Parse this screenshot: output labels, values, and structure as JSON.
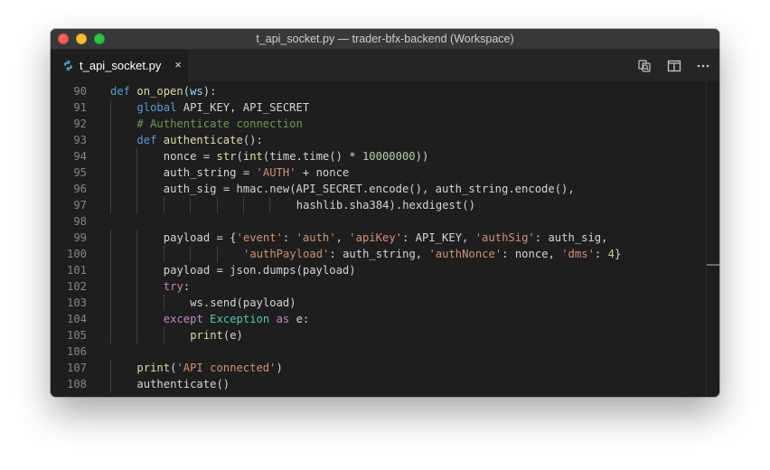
{
  "window": {
    "title": "t_api_socket.py — trader-bfx-backend (Workspace)"
  },
  "tabs": [
    {
      "label": "t_api_socket.py",
      "icon": "python-icon",
      "close": "×"
    }
  ],
  "actions": [
    {
      "name": "open-changes-icon"
    },
    {
      "name": "split-editor-icon"
    },
    {
      "name": "more-actions-icon"
    }
  ],
  "theme": {
    "background": "#1e1e1e",
    "keyword": "#569cd6",
    "function": "#dcdcaa",
    "control": "#c586c0",
    "string": "#ce9178",
    "number": "#b5cea8",
    "comment": "#6a9955",
    "class": "#4ec9b0",
    "variable": "#9cdcfe"
  },
  "code_lines": [
    {
      "n": "90",
      "indent": 0,
      "tokens": [
        [
          "kw-def",
          "def"
        ],
        [
          "plain",
          " "
        ],
        [
          "fn",
          "on_open"
        ],
        [
          "plain",
          "("
        ],
        [
          "var",
          "ws"
        ],
        [
          "plain",
          "):"
        ]
      ]
    },
    {
      "n": "91",
      "indent": 1,
      "tokens": [
        [
          "kw-def",
          "global"
        ],
        [
          "plain",
          " API_KEY, API_SECRET"
        ]
      ]
    },
    {
      "n": "92",
      "indent": 1,
      "tokens": [
        [
          "cmt",
          "# Authenticate connection"
        ]
      ]
    },
    {
      "n": "93",
      "indent": 1,
      "tokens": [
        [
          "kw-def",
          "def"
        ],
        [
          "plain",
          " "
        ],
        [
          "fn",
          "authenticate"
        ],
        [
          "plain",
          "():"
        ]
      ]
    },
    {
      "n": "94",
      "indent": 2,
      "tokens": [
        [
          "plain",
          "nonce = "
        ],
        [
          "fn",
          "str"
        ],
        [
          "plain",
          "("
        ],
        [
          "fn",
          "int"
        ],
        [
          "plain",
          "(time.time() * "
        ],
        [
          "num",
          "10000000"
        ],
        [
          "plain",
          "))"
        ]
      ]
    },
    {
      "n": "95",
      "indent": 2,
      "tokens": [
        [
          "plain",
          "auth_string = "
        ],
        [
          "str",
          "'AUTH'"
        ],
        [
          "plain",
          " + nonce"
        ]
      ]
    },
    {
      "n": "96",
      "indent": 2,
      "tokens": [
        [
          "plain",
          "auth_sig = hmac.new(API_SECRET.encode(), auth_string.encode(),"
        ]
      ]
    },
    {
      "n": "97",
      "indent": 7,
      "tokens": [
        [
          "plain",
          "hashlib.sha384).hexdigest()"
        ]
      ]
    },
    {
      "n": "98",
      "indent": 0,
      "tokens": []
    },
    {
      "n": "99",
      "indent": 2,
      "tokens": [
        [
          "plain",
          "payload = {"
        ],
        [
          "str",
          "'event'"
        ],
        [
          "plain",
          ": "
        ],
        [
          "str",
          "'auth'"
        ],
        [
          "plain",
          ", "
        ],
        [
          "str",
          "'apiKey'"
        ],
        [
          "plain",
          ": API_KEY, "
        ],
        [
          "str",
          "'authSig'"
        ],
        [
          "plain",
          ": auth_sig,"
        ]
      ]
    },
    {
      "n": "100",
      "indent": 5,
      "tokens": [
        [
          "str",
          "'authPayload'"
        ],
        [
          "plain",
          ": auth_string, "
        ],
        [
          "str",
          "'authNonce'"
        ],
        [
          "plain",
          ": nonce, "
        ],
        [
          "str",
          "'dms'"
        ],
        [
          "plain",
          ": "
        ],
        [
          "num",
          "4"
        ],
        [
          "plain",
          "}"
        ]
      ]
    },
    {
      "n": "101",
      "indent": 2,
      "tokens": [
        [
          "plain",
          "payload = json.dumps(payload)"
        ]
      ]
    },
    {
      "n": "102",
      "indent": 2,
      "tokens": [
        [
          "kw",
          "try"
        ],
        [
          "plain",
          ":"
        ]
      ]
    },
    {
      "n": "103",
      "indent": 3,
      "tokens": [
        [
          "plain",
          "ws.send(payload)"
        ]
      ]
    },
    {
      "n": "104",
      "indent": 2,
      "tokens": [
        [
          "kw",
          "except"
        ],
        [
          "plain",
          " "
        ],
        [
          "cls",
          "Exception"
        ],
        [
          "plain",
          " "
        ],
        [
          "kw",
          "as"
        ],
        [
          "plain",
          " e:"
        ]
      ]
    },
    {
      "n": "105",
      "indent": 3,
      "tokens": [
        [
          "fn",
          "print"
        ],
        [
          "plain",
          "(e)"
        ]
      ]
    },
    {
      "n": "106",
      "indent": 0,
      "tokens": []
    },
    {
      "n": "107",
      "indent": 1,
      "tokens": [
        [
          "fn",
          "print"
        ],
        [
          "plain",
          "("
        ],
        [
          "str",
          "'API connected'"
        ],
        [
          "plain",
          ")"
        ]
      ]
    },
    {
      "n": "108",
      "indent": 1,
      "tokens": [
        [
          "plain",
          "authenticate()"
        ]
      ]
    }
  ]
}
